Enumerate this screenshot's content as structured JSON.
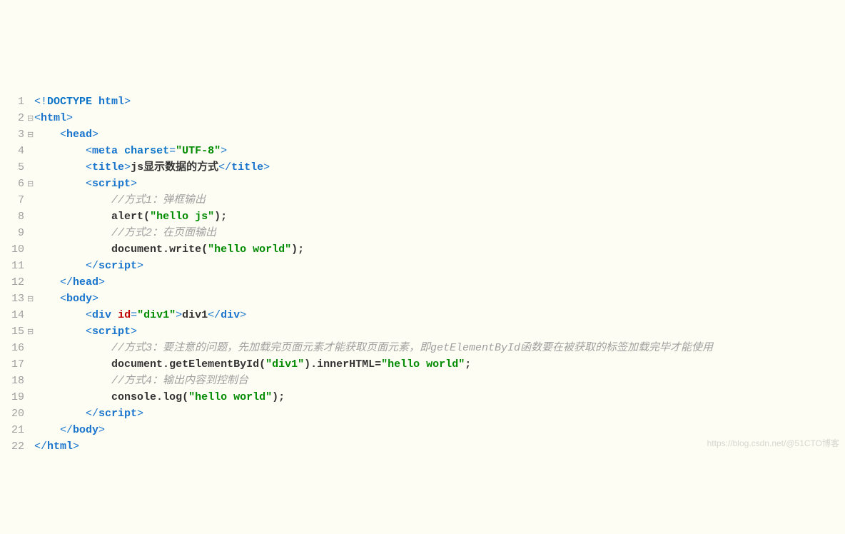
{
  "watermark": "https://blog.csdn.net/@51CTO博客",
  "lines": [
    {
      "n": "1",
      "fold": " ",
      "indent": "",
      "tokens": [
        {
          "cls": "angle",
          "t": "<!"
        },
        {
          "cls": "kw",
          "t": "DOCTYPE"
        },
        {
          "cls": "angle",
          "t": " "
        },
        {
          "cls": "tag",
          "t": "html"
        },
        {
          "cls": "angle",
          "t": ">"
        }
      ]
    },
    {
      "n": "2",
      "fold": "⊟",
      "indent": "",
      "tokens": [
        {
          "cls": "angle",
          "t": "<"
        },
        {
          "cls": "tag",
          "t": "html"
        },
        {
          "cls": "angle",
          "t": ">"
        }
      ]
    },
    {
      "n": "3",
      "fold": "⊟",
      "indent": "    ",
      "tokens": [
        {
          "cls": "angle",
          "t": "<"
        },
        {
          "cls": "tag",
          "t": "head"
        },
        {
          "cls": "angle",
          "t": ">"
        }
      ]
    },
    {
      "n": "4",
      "fold": " ",
      "indent": "        ",
      "tokens": [
        {
          "cls": "angle",
          "t": "<"
        },
        {
          "cls": "tag",
          "t": "meta"
        },
        {
          "cls": "angle",
          "t": " "
        },
        {
          "cls": "kw",
          "t": "charset"
        },
        {
          "cls": "angle",
          "t": "="
        },
        {
          "cls": "val",
          "t": "\"UTF-8\""
        },
        {
          "cls": "angle",
          "t": ">"
        }
      ]
    },
    {
      "n": "5",
      "fold": " ",
      "indent": "        ",
      "tokens": [
        {
          "cls": "angle",
          "t": "<"
        },
        {
          "cls": "tag",
          "t": "title"
        },
        {
          "cls": "angle",
          "t": ">"
        },
        {
          "cls": "plain",
          "t": "js显示数据的方式"
        },
        {
          "cls": "angle",
          "t": "</"
        },
        {
          "cls": "tag",
          "t": "title"
        },
        {
          "cls": "angle",
          "t": ">"
        }
      ]
    },
    {
      "n": "6",
      "fold": "⊟",
      "indent": "        ",
      "tokens": [
        {
          "cls": "angle",
          "t": "<"
        },
        {
          "cls": "tag",
          "t": "script"
        },
        {
          "cls": "angle",
          "t": ">"
        }
      ]
    },
    {
      "n": "7",
      "fold": " ",
      "indent": "            ",
      "tokens": [
        {
          "cls": "cmt",
          "t": "//方式1：弹框输出"
        }
      ]
    },
    {
      "n": "8",
      "fold": " ",
      "indent": "            ",
      "tokens": [
        {
          "cls": "plain",
          "t": "alert"
        },
        {
          "cls": "plain",
          "t": "("
        },
        {
          "cls": "str",
          "t": "\"hello js\""
        },
        {
          "cls": "plain",
          "t": ");"
        }
      ]
    },
    {
      "n": "9",
      "fold": " ",
      "indent": "            ",
      "tokens": [
        {
          "cls": "cmt",
          "t": "//方式2：在页面输出"
        }
      ]
    },
    {
      "n": "10",
      "fold": " ",
      "indent": "            ",
      "tokens": [
        {
          "cls": "plain",
          "t": "document"
        },
        {
          "cls": "plain",
          "t": "."
        },
        {
          "cls": "plain",
          "t": "write"
        },
        {
          "cls": "plain",
          "t": "("
        },
        {
          "cls": "str",
          "t": "\"hello world\""
        },
        {
          "cls": "plain",
          "t": ");"
        }
      ]
    },
    {
      "n": "11",
      "fold": " ",
      "indent": "        ",
      "tokens": [
        {
          "cls": "angle",
          "t": "</"
        },
        {
          "cls": "tag",
          "t": "script"
        },
        {
          "cls": "angle",
          "t": ">"
        }
      ]
    },
    {
      "n": "12",
      "fold": " ",
      "indent": "    ",
      "tokens": [
        {
          "cls": "angle",
          "t": "</"
        },
        {
          "cls": "tag",
          "t": "head"
        },
        {
          "cls": "angle",
          "t": ">"
        }
      ]
    },
    {
      "n": "13",
      "fold": "⊟",
      "indent": "    ",
      "tokens": [
        {
          "cls": "angle",
          "t": "<"
        },
        {
          "cls": "tag",
          "t": "body"
        },
        {
          "cls": "angle",
          "t": ">"
        }
      ]
    },
    {
      "n": "14",
      "fold": " ",
      "indent": "        ",
      "tokens": [
        {
          "cls": "angle",
          "t": "<"
        },
        {
          "cls": "tag",
          "t": "div"
        },
        {
          "cls": "angle",
          "t": " "
        },
        {
          "cls": "attr",
          "t": "id"
        },
        {
          "cls": "angle",
          "t": "="
        },
        {
          "cls": "val",
          "t": "\"div1\""
        },
        {
          "cls": "angle",
          "t": ">"
        },
        {
          "cls": "plain",
          "t": "div1"
        },
        {
          "cls": "angle",
          "t": "</"
        },
        {
          "cls": "tag",
          "t": "div"
        },
        {
          "cls": "angle",
          "t": ">"
        }
      ]
    },
    {
      "n": "15",
      "fold": "⊟",
      "indent": "        ",
      "tokens": [
        {
          "cls": "angle",
          "t": "<"
        },
        {
          "cls": "tag",
          "t": "script"
        },
        {
          "cls": "angle",
          "t": ">"
        }
      ]
    },
    {
      "n": "16",
      "fold": " ",
      "indent": "            ",
      "tokens": [
        {
          "cls": "cmt",
          "t": "//方式3：要注意的问题，先加载完页面元素才能获取页面元素，即getElementById函数要在被获取的标签加载完毕才能使用"
        }
      ]
    },
    {
      "n": "17",
      "fold": " ",
      "indent": "            ",
      "tokens": [
        {
          "cls": "plain",
          "t": "document"
        },
        {
          "cls": "plain",
          "t": "."
        },
        {
          "cls": "plain",
          "t": "getElementById"
        },
        {
          "cls": "plain",
          "t": "("
        },
        {
          "cls": "str",
          "t": "\"div1\""
        },
        {
          "cls": "plain",
          "t": ")."
        },
        {
          "cls": "plain",
          "t": "innerHTML"
        },
        {
          "cls": "plain",
          "t": "="
        },
        {
          "cls": "str",
          "t": "\"hello world\""
        },
        {
          "cls": "plain",
          "t": ";"
        }
      ]
    },
    {
      "n": "18",
      "fold": " ",
      "indent": "            ",
      "tokens": [
        {
          "cls": "cmt",
          "t": "//方式4：输出内容到控制台"
        }
      ]
    },
    {
      "n": "19",
      "fold": " ",
      "indent": "            ",
      "tokens": [
        {
          "cls": "plain",
          "t": "console"
        },
        {
          "cls": "plain",
          "t": "."
        },
        {
          "cls": "plain",
          "t": "log"
        },
        {
          "cls": "plain",
          "t": "("
        },
        {
          "cls": "str",
          "t": "\"hello world\""
        },
        {
          "cls": "plain",
          "t": ");"
        }
      ]
    },
    {
      "n": "20",
      "fold": " ",
      "indent": "        ",
      "tokens": [
        {
          "cls": "angle",
          "t": "</"
        },
        {
          "cls": "tag",
          "t": "script"
        },
        {
          "cls": "angle",
          "t": ">"
        }
      ]
    },
    {
      "n": "21",
      "fold": " ",
      "indent": "    ",
      "tokens": [
        {
          "cls": "angle",
          "t": "</"
        },
        {
          "cls": "tag",
          "t": "body"
        },
        {
          "cls": "angle",
          "t": ">"
        }
      ]
    },
    {
      "n": "22",
      "fold": " ",
      "indent": "",
      "tokens": [
        {
          "cls": "angle",
          "t": "</"
        },
        {
          "cls": "tag",
          "t": "html"
        },
        {
          "cls": "angle",
          "t": ">"
        }
      ]
    }
  ]
}
